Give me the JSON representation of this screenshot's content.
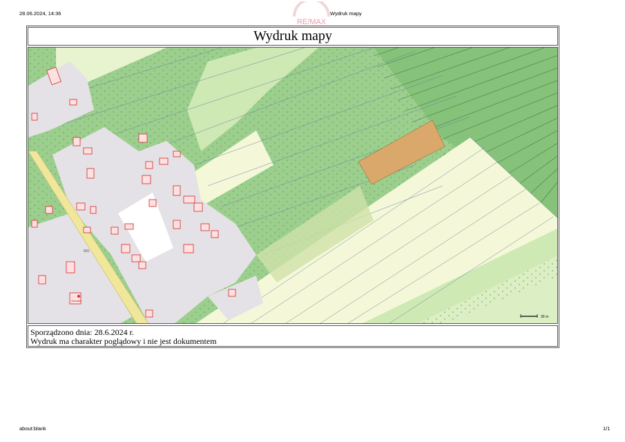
{
  "browser_header": {
    "date_time": "28.06.2024, 14:36",
    "page_title": "Wydruk mapy"
  },
  "browser_footer": {
    "url": "about:blank",
    "page_number": "1/1"
  },
  "watermark": {
    "text": "RE/MAX"
  },
  "document": {
    "title": "Wydruk mapy",
    "created_line": "Sporządzono dnia: 28.6.2024 r.",
    "disclaimer": "Wydruk ma charakter poglądowy i nie jest dokumentem"
  },
  "map": {
    "scale_label": "30 m",
    "road_number": "601",
    "building_label": "Ośrodek",
    "colors": {
      "forest": "#9ccf8e",
      "forest_dark": "#86c279",
      "meadow": "#dcefc4",
      "field": "#f4f8d8",
      "built_area": "#e4e2e6",
      "road": "#f1e79a",
      "selected_parcel": "#d9a86a",
      "building": "#ffe1e1",
      "building_outline": "#d43a3a"
    }
  }
}
